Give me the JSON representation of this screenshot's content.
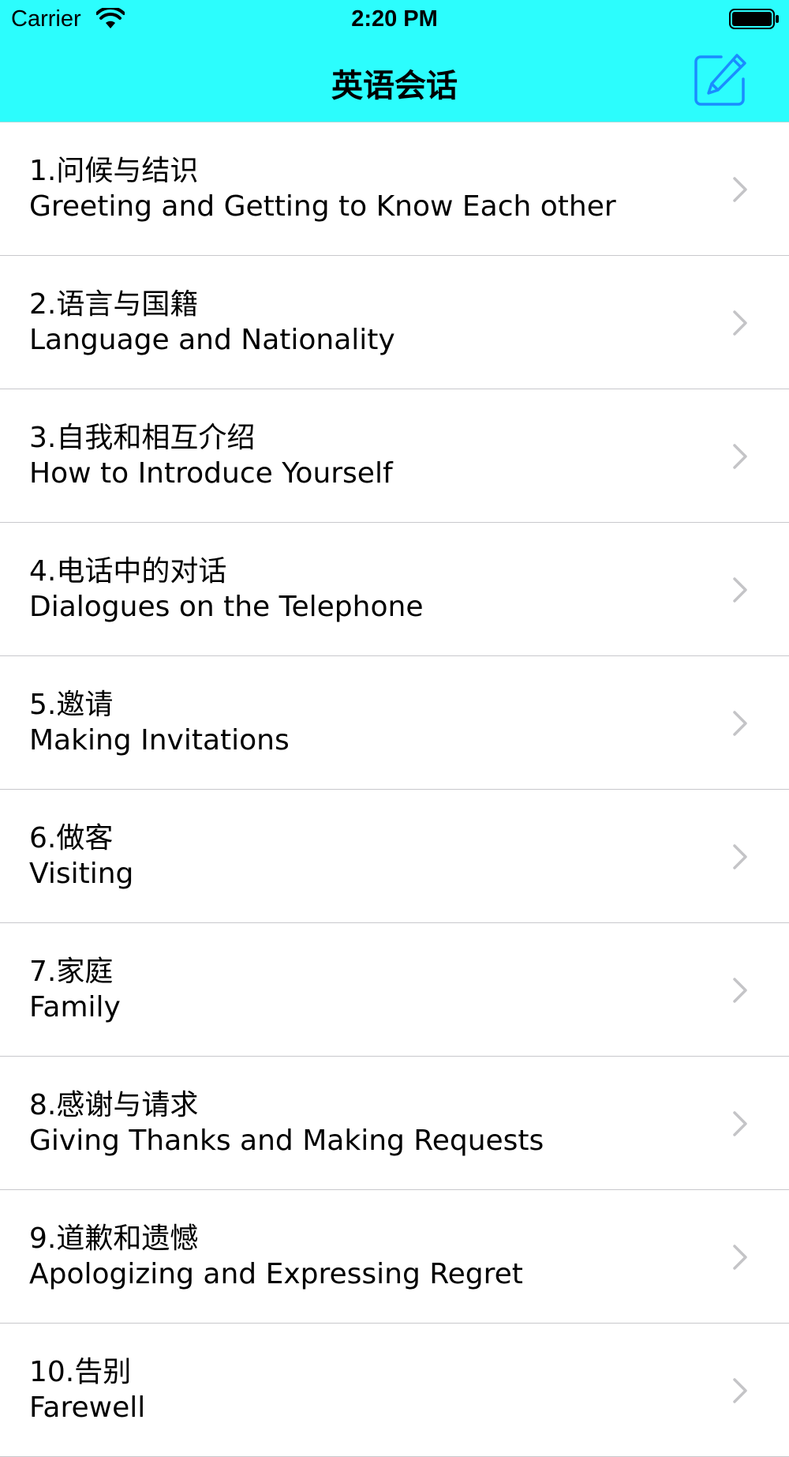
{
  "status_bar": {
    "carrier": "Carrier",
    "time": "2:20 PM",
    "wifi_icon": "wifi-icon",
    "battery_icon": "battery-icon"
  },
  "nav": {
    "title": "英语会话",
    "compose_icon": "compose-icon"
  },
  "colors": {
    "header_bg": "#2cfdfd",
    "accent": "#1a8cff",
    "separator": "#c8c8cc",
    "chevron": "#c4c4c7"
  },
  "lessons": [
    {
      "zh": "1.问候与结识",
      "en": "Greeting and Getting to Know Each other"
    },
    {
      "zh": "2.语言与国籍",
      "en": "Language and Nationality"
    },
    {
      "zh": "3.自我和相互介绍",
      "en": "How to Introduce Yourself"
    },
    {
      "zh": "4.电话中的对话",
      "en": "Dialogues on the Telephone"
    },
    {
      "zh": "5.邀请",
      "en": "Making Invitations"
    },
    {
      "zh": "6.做客",
      "en": "Visiting"
    },
    {
      "zh": "7.家庭",
      "en": "Family"
    },
    {
      "zh": "8.感谢与请求",
      "en": "Giving Thanks and Making Requests"
    },
    {
      "zh": "9.道歉和遗憾",
      "en": "Apologizing and Expressing Regret"
    },
    {
      "zh": "10.告别",
      "en": "Farewell"
    }
  ]
}
